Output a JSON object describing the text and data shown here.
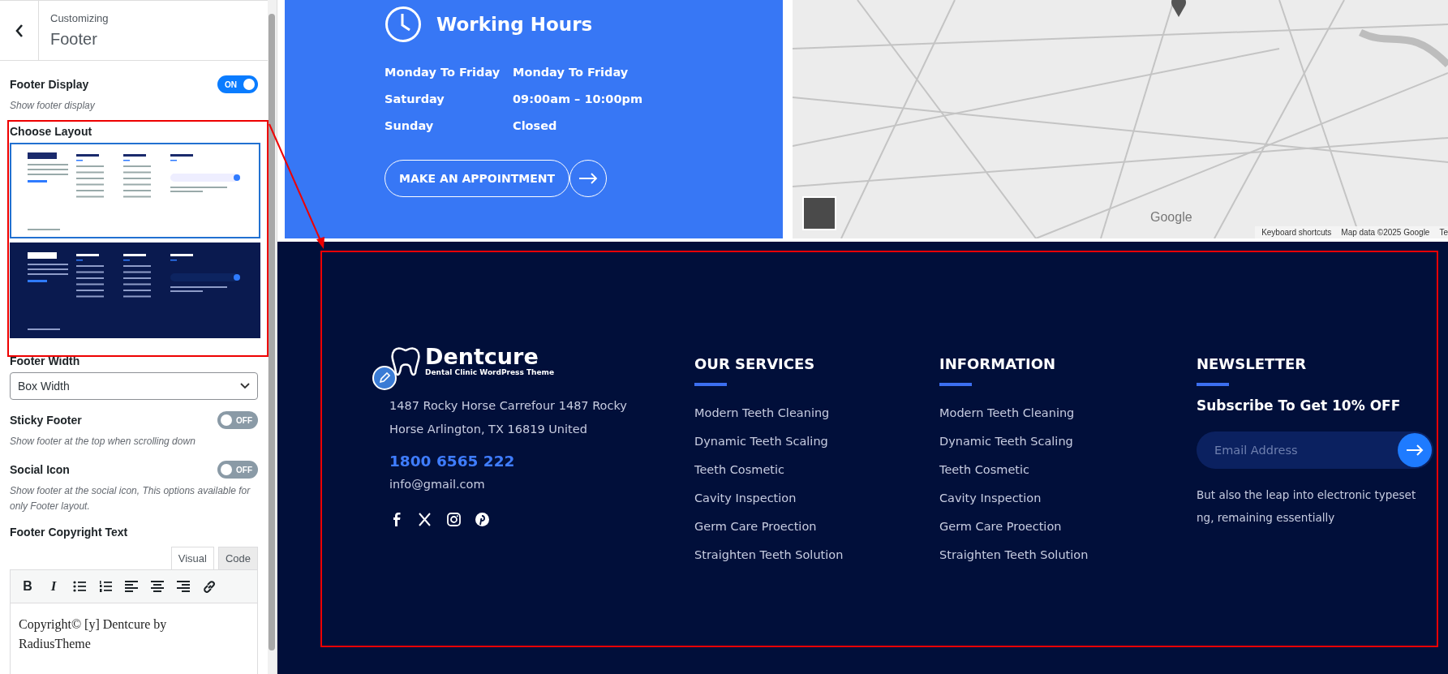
{
  "panel": {
    "eyebrow": "Customizing",
    "title": "Footer"
  },
  "settings": [
    {
      "kind": "toggle",
      "label": "Footer Display",
      "description": "Show footer display",
      "on": true,
      "toggle_text": "ON"
    },
    {
      "kind": "layouts",
      "label": "Choose Layout",
      "options": [
        {
          "kind": "light",
          "selected": true
        },
        {
          "kind": "dark",
          "selected": false
        }
      ]
    },
    {
      "kind": "select",
      "label": "Footer Width",
      "value": "Box Width"
    },
    {
      "kind": "toggle",
      "label": "Sticky Footer",
      "description": "Show footer at the top when scrolling down",
      "on": false,
      "toggle_text": "OFF"
    },
    {
      "kind": "toggle",
      "label": "Social Icon",
      "description": "Show footer at the social icon, This options available for only Footer layout.",
      "on": false,
      "toggle_text": "OFF"
    },
    {
      "kind": "editor",
      "label": "Footer Copyright Text",
      "tabs": [
        {
          "label": "Visual",
          "selected": true
        },
        {
          "label": "Code",
          "selected": false
        }
      ],
      "toolbar": [
        {
          "kind": "bold",
          "label": "B"
        },
        {
          "kind": "italic",
          "label": "I"
        },
        {
          "kind": "bullets"
        },
        {
          "kind": "numbers"
        },
        {
          "kind": "left"
        },
        {
          "kind": "center"
        },
        {
          "kind": "right"
        },
        {
          "kind": "link"
        }
      ],
      "content": "Copyright© [y] Dentcure by RadiusTheme"
    }
  ],
  "hours": {
    "title": "Working Hours",
    "rows": [
      {
        "day": "Monday To Friday",
        "time": "Monday To Friday"
      },
      {
        "day": "Saturday",
        "time": "09:00am – 10:00pm"
      },
      {
        "day": "Sunday",
        "time": "Closed"
      }
    ],
    "button": "MAKE AN APPOINTMENT"
  },
  "map": {
    "logo": "Google",
    "attribution": [
      "Keyboard shortcuts",
      "Map data ©2025 Google",
      "Te"
    ]
  },
  "footer": {
    "brand": {
      "name": "Dentcure",
      "tagline": "Dental Clinic WordPress Theme"
    },
    "address": "1487 Rocky Horse Carrefour 1487 Rocky Horse Arlington, TX 16819 United",
    "phone": "1800 6565 222",
    "email": "info@gmail.com",
    "columns": [
      {
        "heading": "OUR SERVICES",
        "links": [
          "Modern Teeth Cleaning",
          "Dynamic Teeth Scaling",
          "Teeth Cosmetic",
          "Cavity Inspection",
          "Germ Care Proection",
          "Straighten Teeth Solution"
        ]
      },
      {
        "heading": "INFORMATION",
        "links": [
          "Modern Teeth Cleaning",
          "Dynamic Teeth Scaling",
          "Teeth Cosmetic",
          "Cavity Inspection",
          "Germ Care Proection",
          "Straighten Teeth Solution"
        ]
      }
    ],
    "newsletter": {
      "heading": "NEWSLETTER",
      "offer": "Subscribe To Get **10%** OFF",
      "placeholder": "Email Address",
      "note": "But also the leap into electronic typeset ng, remaining essentially"
    }
  }
}
